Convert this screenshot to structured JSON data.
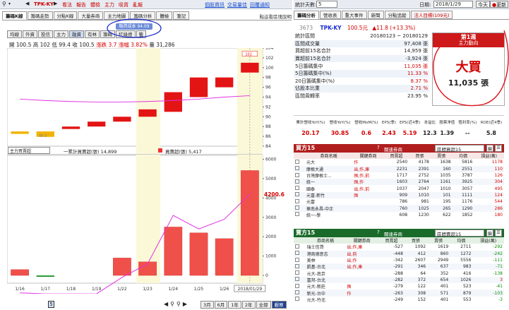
{
  "toolbar": {
    "symbol": "TPK-KY",
    "buttons": [
      "看法",
      "報告",
      "體檢",
      "主力",
      "吸貨",
      "亂報"
    ],
    "links": [
      "個股資訊",
      "交易量佳",
      "回覆通知"
    ]
  },
  "left_tabs": [
    "籌碼K線",
    "籌碼走勢",
    "分點K線",
    "大量券商",
    "主力地圖",
    "籌碼分析",
    "體檢",
    "筆記"
  ],
  "left_note": "點這看區塊說明",
  "sub_tabs": [
    "均線",
    "外資",
    "投信",
    "主力",
    "融資",
    "有林",
    "籌碼",
    "紅綠燈",
    "籤"
  ],
  "badge": "融資成本 94.09",
  "ohlc": {
    "open_label": "開 100.5",
    "high_label": "高 102",
    "low_label": "低 99.4",
    "close_label": "收 100.5",
    "chg_label": "漲跌 3.7",
    "pct_label": "漲幅 3.82%",
    "vol_label": "量 31,286"
  },
  "price_axis": [
    "104",
    "102",
    "100",
    "98",
    "96",
    "94",
    "92",
    "90",
    "88",
    "86",
    "84"
  ],
  "price_tags": {
    "last": "102",
    "low": "86.3"
  },
  "chart_data": [
    {
      "type": "bar",
      "categories": [
        "1/16",
        "1/17",
        "1/18",
        "1/19",
        "1/22",
        "1/23",
        "1/24",
        "1/25",
        "1/26",
        "2018/01/29"
      ],
      "candles": [
        {
          "o": 87,
          "c": 86.5
        },
        {
          "o": 87,
          "c": 85.9
        },
        {
          "o": 87.5,
          "c": 88
        },
        {
          "o": 88,
          "c": 89
        },
        {
          "o": 89,
          "c": 90
        },
        {
          "o": 90,
          "c": 91.5
        },
        {
          "o": 91,
          "c": 95
        },
        {
          "o": 94,
          "c": 98
        },
        {
          "o": 96,
          "c": 98
        },
        {
          "o": 99,
          "c": 101
        }
      ],
      "ylim": [
        84,
        104
      ]
    },
    {
      "type": "bar",
      "categories": [
        "1/16",
        "1/17",
        "1/18",
        "1/19",
        "1/22",
        "1/23",
        "1/24",
        "1/25",
        "1/26",
        "2018/01/29"
      ],
      "values": [
        300,
        -50,
        0,
        0,
        900,
        700,
        2500,
        2200,
        1900,
        5417
      ],
      "line": [
        -900,
        -950,
        -950,
        -950,
        -100,
        600,
        3100,
        2400,
        2900,
        4200
      ],
      "ylim": [
        -400,
        6200
      ]
    }
  ],
  "lower": {
    "selector": "主力買賣超",
    "legend1": "一累計買賣超(張) 14,899",
    "legend2": "買賣超(張) 5,417",
    "big": "4200.6",
    "axis": [
      "6000",
      "5000",
      "4000",
      "3000",
      "2000",
      "1000",
      "0"
    ]
  },
  "xaxis": {
    "labels": [
      "1/16",
      "1/17",
      "1/18",
      "1/19",
      "1/22",
      "1/23",
      "1/24",
      "1/25",
      "1/26",
      "2018/01/29"
    ],
    "year": "2018"
  },
  "bottom": {
    "num": "5",
    "periods": [
      "3月",
      "6月",
      "1年",
      "2年",
      "全部",
      "觀察"
    ]
  },
  "right_top": {
    "days_label": "統計天數:",
    "days": "5",
    "date_label": "日期:",
    "date": "2018/1/29",
    "today": "今天",
    "refresh": "更新"
  },
  "right_tabs": [
    "籌碼分析",
    "營收表",
    "重大事件",
    "新聞",
    "分點追蹤",
    "法人目標(109元)"
  ],
  "quote": {
    "code": "3673",
    "name": "TPK-KY",
    "price": "100.5元",
    "chg": "▲11.8 (+13.3%)"
  },
  "stats": [
    [
      "統計區間",
      "20180123 ~ 20180129"
    ],
    [
      "區間成交量",
      "97,408 張"
    ],
    [
      "買超前15名合計",
      "14,959 張"
    ],
    [
      "賣超前15名合計",
      "-3,924 張"
    ],
    [
      "5日籌碼集中",
      "11,035 張"
    ],
    [
      "5日籌碼集中(%)",
      "11.33 %"
    ],
    [
      "20日籌碼集中(%)",
      "8.37 %"
    ],
    [
      "佔股本比重",
      "2.71 %"
    ],
    [
      "區間周轉率",
      "23.95 %"
    ]
  ],
  "rank": {
    "label": "第1週",
    "sub": "主力動向",
    "big": "大買",
    "value": "11,035 張"
  },
  "fund_hdr": [
    "累計營收YoY(%)",
    "營收YoY(%)",
    "營收MoM(%)",
    "EPS(季)",
    "EPS(近4季)",
    "本益比",
    "股票淨值",
    "殖利率(%)",
    "ROE(近4季)"
  ],
  "fund_val": [
    "20.17",
    "30.85",
    "0.6",
    "2.43",
    "5.19",
    "12.3",
    "1.39",
    "--",
    "5.8"
  ],
  "buy": {
    "title": "買方15",
    "sel_label": "關連券商",
    "sel": "區間買超15",
    "cols": [
      "券商名稱",
      "關鍵券商",
      "買賣超",
      "買張",
      "賣張",
      "均價",
      "損益(萬)"
    ],
    "rows": [
      [
        "元大",
        "作",
        "2540",
        "4178",
        "1638",
        "5816",
        "1178"
      ],
      [
        "摩根大通",
        "出,作,庫",
        "2231",
        "2391",
        "160",
        "2551",
        "110"
      ],
      [
        "台灣摩根士...",
        "囤,作,前",
        "1717",
        "2752",
        "1035",
        "3787",
        "126"
      ],
      [
        "統一",
        "囤,作",
        "1603",
        "2764",
        "1161",
        "3925",
        "304"
      ],
      [
        "國泰",
        "出,作,前",
        "1037",
        "2047",
        "1010",
        "3057",
        "495"
      ],
      [
        "元富-新竹",
        "囤",
        "909",
        "1010",
        "101",
        "1111",
        "124"
      ],
      [
        "元富",
        "",
        "786",
        "981",
        "195",
        "1176",
        "544"
      ],
      [
        "華南永昌-中正",
        "",
        "760",
        "1025",
        "265",
        "1290",
        "286"
      ],
      [
        "統一-學",
        "",
        "608",
        "1230",
        "622",
        "1852",
        "180"
      ]
    ]
  },
  "sell": {
    "title": "賣方15",
    "sel_label": "關連券商",
    "sel": "區間賣超15",
    "cols": [
      "券商名稱",
      "關鍵券商",
      "買賣超",
      "買張",
      "賣張",
      "均價",
      "損益(萬)"
    ],
    "rows": [
      [
        "瑞士信貸",
        "出,作,庫",
        "-527",
        "1092",
        "1619",
        "2711",
        "-292"
      ],
      [
        "港商德意志",
        "出,前",
        "-448",
        "412",
        "860",
        "1272",
        "-242"
      ],
      [
        "美林",
        "出,作",
        "-342",
        "2607",
        "2949",
        "5556",
        "-111"
      ],
      [
        "凱基-台北",
        "出,作,庫",
        "-291",
        "346",
        "637",
        "983",
        "-71"
      ],
      [
        "元大-南京",
        "",
        "-288",
        "64",
        "352",
        "416",
        "-138"
      ],
      [
        "富邦-台北",
        "",
        "-282",
        "372",
        "654",
        "1026",
        "3"
      ],
      [
        "元大-新莊",
        "囤",
        "-279",
        "122",
        "401",
        "523",
        "-41"
      ],
      [
        "新光-台中",
        "作",
        "-263",
        "308",
        "571",
        "879",
        "-103"
      ],
      [
        "元大-竹北",
        "",
        "-249",
        "152",
        "401",
        "553",
        "-3"
      ]
    ]
  }
}
